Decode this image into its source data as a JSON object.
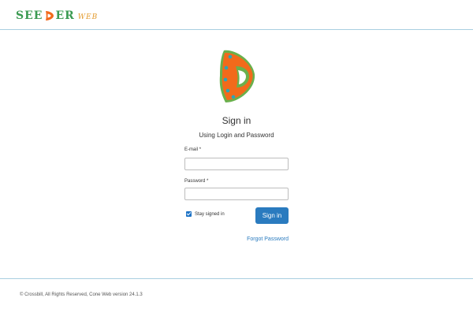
{
  "header": {
    "brand_left": "SEE",
    "brand_right": "ER",
    "brand_sub": "WEB"
  },
  "form": {
    "title": "Sign in",
    "subtitle": "Using Login and Password",
    "email_label": "E-mail",
    "email_required": "*",
    "email_value": "",
    "password_label": "Password",
    "password_required": "*",
    "password_value": "",
    "remember_label": "Stay signed in",
    "remember_checked": true,
    "submit_label": "Sign in",
    "forgot_label": "Forgot Password"
  },
  "footer": {
    "text": "© Crossbill, All Rights Reserved, Cone Web version 24.1.3"
  },
  "colors": {
    "accent": "#2a7bbf",
    "brand_green": "#3b9a52",
    "brand_orange": "#f26a1b",
    "divider": "#a8cfe0"
  },
  "icons": {
    "logo": "seeder-logo-icon",
    "brand_mark": "seeder-brand-mark-icon",
    "checkbox": "check-icon"
  }
}
